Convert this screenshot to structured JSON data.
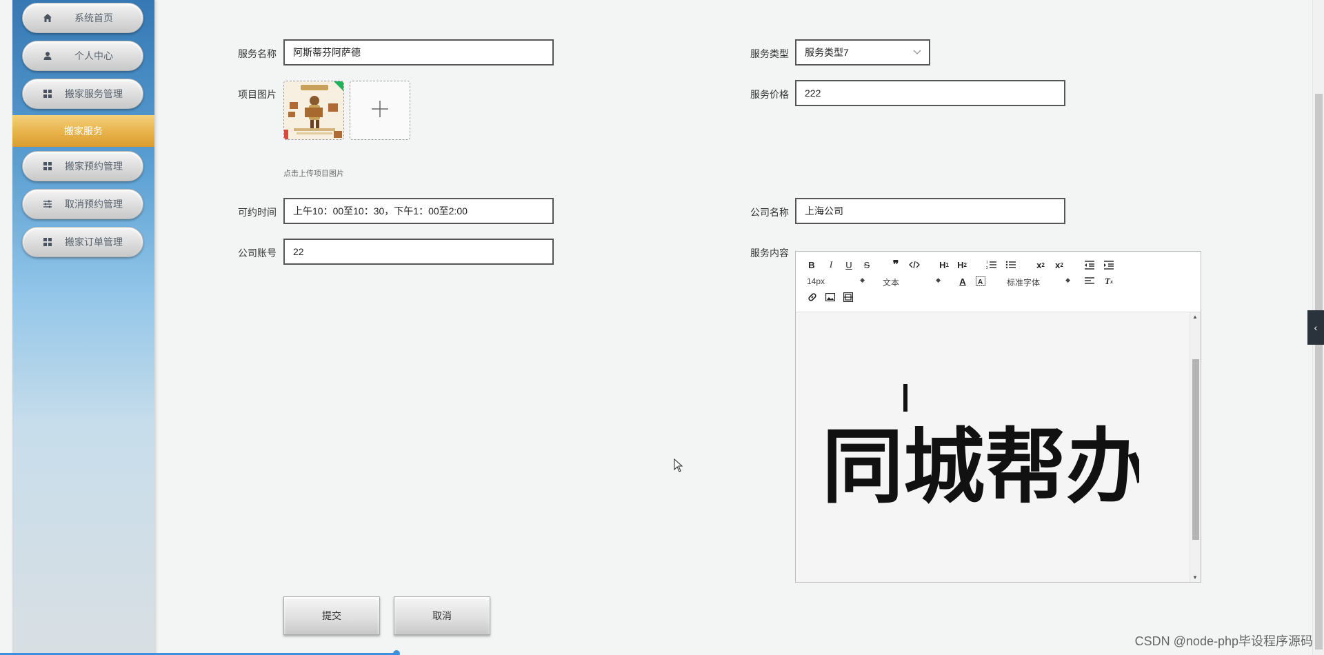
{
  "sidebar": {
    "items": [
      {
        "label": "系统首页",
        "icon": "home-icon"
      },
      {
        "label": "个人中心",
        "icon": "user-icon"
      },
      {
        "label": "搬家服务管理",
        "icon": "grid-icon"
      },
      {
        "label": "搬家预约管理",
        "icon": "grid-icon"
      },
      {
        "label": "取消预约管理",
        "icon": "sliders-icon"
      },
      {
        "label": "搬家订单管理",
        "icon": "grid-icon"
      }
    ],
    "active_sub": "搬家服务"
  },
  "form": {
    "service_name_label": "服务名称",
    "service_name_value": "阿斯蒂芬阿萨德",
    "service_type_label": "服务类型",
    "service_type_value": "服务类型7",
    "project_image_label": "项目图片",
    "upload_hint": "点击上传项目图片",
    "service_price_label": "服务价格",
    "service_price_value": "222",
    "available_time_label": "可约时间",
    "available_time_value": "上午10：00至10：30，下午1：00至2:00",
    "company_name_label": "公司名称",
    "company_name_value": "上海公司",
    "company_account_label": "公司账号",
    "company_account_value": "22",
    "service_content_label": "服务内容"
  },
  "editor": {
    "font_size": "14px",
    "block_format": "文本",
    "font_family": "标准字体",
    "content_logo_text": "同城帮办"
  },
  "buttons": {
    "submit": "提交",
    "cancel": "取消"
  },
  "watermark": "CSDN @node-php毕设程序源码",
  "colors": {
    "sidebar_top": "#3578b4",
    "active_gold": "#e8b24a"
  }
}
